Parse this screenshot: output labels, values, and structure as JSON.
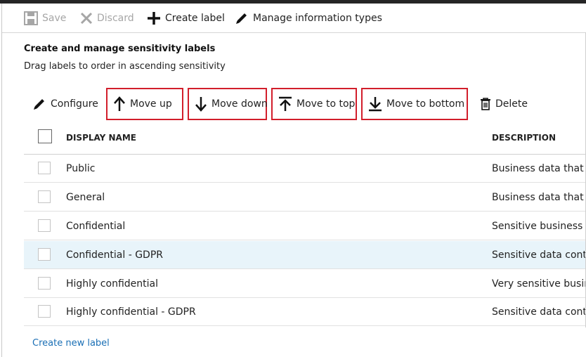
{
  "toolbar": {
    "save_label": "Save",
    "discard_label": "Discard",
    "create_label": "Create label",
    "manage_label": "Manage information types"
  },
  "section": {
    "title": "Create and manage sensitivity labels",
    "subtitle": "Drag labels to order in ascending sensitivity"
  },
  "commands": {
    "configure": "Configure",
    "move_up": "Move up",
    "move_down": "Move down",
    "move_to_top": "Move to top",
    "move_to_bottom": "Move to bottom",
    "delete": "Delete"
  },
  "table": {
    "columns": [
      "DISPLAY NAME",
      "DESCRIPTION"
    ],
    "rows": [
      {
        "name": "Public",
        "description": "Business data that is"
      },
      {
        "name": "General",
        "description": "Business data that is"
      },
      {
        "name": "Confidential",
        "description": "Sensitive business da"
      },
      {
        "name": "Confidential - GDPR",
        "description": "Sensitive data contai"
      },
      {
        "name": "Highly confidential",
        "description": "Very sensitive busine"
      },
      {
        "name": "Highly confidential - GDPR",
        "description": "Sensitive data contai"
      }
    ]
  },
  "footer": {
    "create_new_label": "Create new label"
  },
  "colors": {
    "highlight_box": "#d21e2b",
    "selected_row": "#e8f4fa",
    "link": "#1a6fb5"
  }
}
